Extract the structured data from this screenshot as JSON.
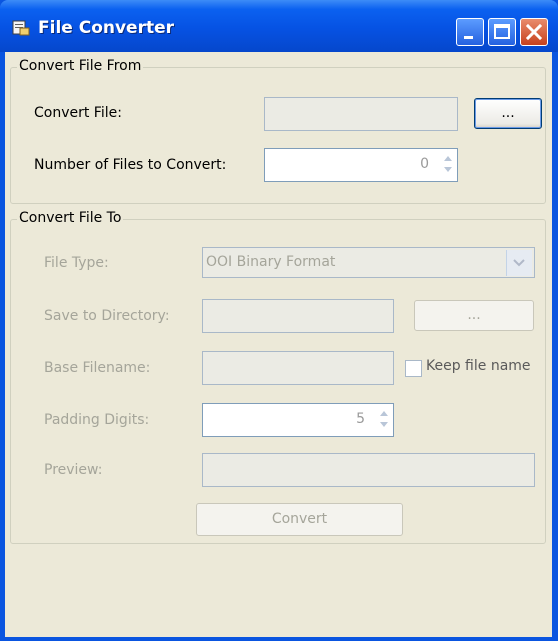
{
  "window": {
    "title": "File Converter",
    "icon": "document-convert-icon",
    "controls": [
      "minimize-icon",
      "maximize-icon",
      "close-icon"
    ]
  },
  "convert_from": {
    "group_title": "Convert File From",
    "convert_file_label": "Convert File:",
    "convert_file_value": "",
    "browse_label": "...",
    "num_files_label": "Number of Files to Convert:",
    "num_files_value": "0"
  },
  "convert_to": {
    "group_title": "Convert File To",
    "file_type_label": "File Type:",
    "file_type_value": "OOI Binary Format",
    "save_dir_label": "Save to Directory:",
    "save_dir_value": "",
    "save_dir_browse_label": "...",
    "base_filename_label": "Base Filename:",
    "base_filename_value": "",
    "keep_file_name_label": "Keep file name",
    "keep_file_name_checked": false,
    "padding_digits_label": "Padding Digits:",
    "padding_digits_value": "5",
    "preview_label": "Preview:",
    "preview_value": "",
    "convert_button_label": "Convert"
  }
}
